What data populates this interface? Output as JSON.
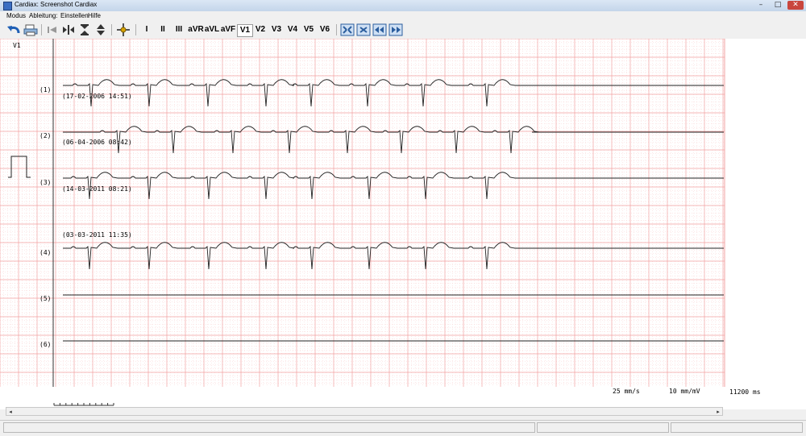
{
  "window": {
    "title": "Cardiax: Screenshot Cardiax",
    "minimize": "–",
    "maximize": "□",
    "close": "✕"
  },
  "menu": [
    "Modus",
    "Ableitung:",
    "Einstellen",
    "Hilfe"
  ],
  "toolbar": {
    "tools": [
      {
        "name": "undo",
        "icon": "undo-arrow-icon"
      },
      {
        "name": "print",
        "icon": "printer-icon"
      },
      {
        "name": "prev",
        "icon": "skip-prev-icon"
      },
      {
        "name": "hstretch",
        "icon": "horizontal-stretch-icon"
      },
      {
        "name": "vcompress",
        "icon": "vertical-compress-icon"
      },
      {
        "name": "vstretch",
        "icon": "vertical-stretch-icon"
      },
      {
        "name": "measure",
        "icon": "crosshair-icon"
      }
    ],
    "leads": [
      "I",
      "II",
      "III",
      "aVR",
      "aVL",
      "aVF",
      "V1",
      "V2",
      "V3",
      "V4",
      "V5",
      "V6"
    ],
    "active_lead": "V1",
    "view_tools": [
      {
        "name": "fit",
        "icon": "fit-all-icon"
      },
      {
        "name": "zoom",
        "icon": "zoom-icon"
      },
      {
        "name": "shift-left",
        "icon": "shift-left-icon"
      },
      {
        "name": "shift-right",
        "icon": "shift-right-icon"
      }
    ]
  },
  "ecg": {
    "lead_label": "V1",
    "traces": [
      {
        "index": "(1)",
        "date": "(17-02-2006 14:51)"
      },
      {
        "index": "(2)",
        "date": "(06-04-2006 08:42)"
      },
      {
        "index": "(3)",
        "date": "(14-03-2011 08:21)"
      },
      {
        "index": "(4)",
        "date": "(03-03-2011 11:35)"
      },
      {
        "index": "(5)",
        "date": ""
      },
      {
        "index": "(6)",
        "date": ""
      }
    ],
    "paper_speed": "25 mm/s",
    "gain": "10 mm/mV",
    "duration": "11200 ms",
    "grid_color": "#f2a0a0",
    "grid_minor_color": "#f8d0d0",
    "trace_color": "#222222"
  },
  "scrollbar": {
    "left": "◂",
    "right": "▸"
  }
}
